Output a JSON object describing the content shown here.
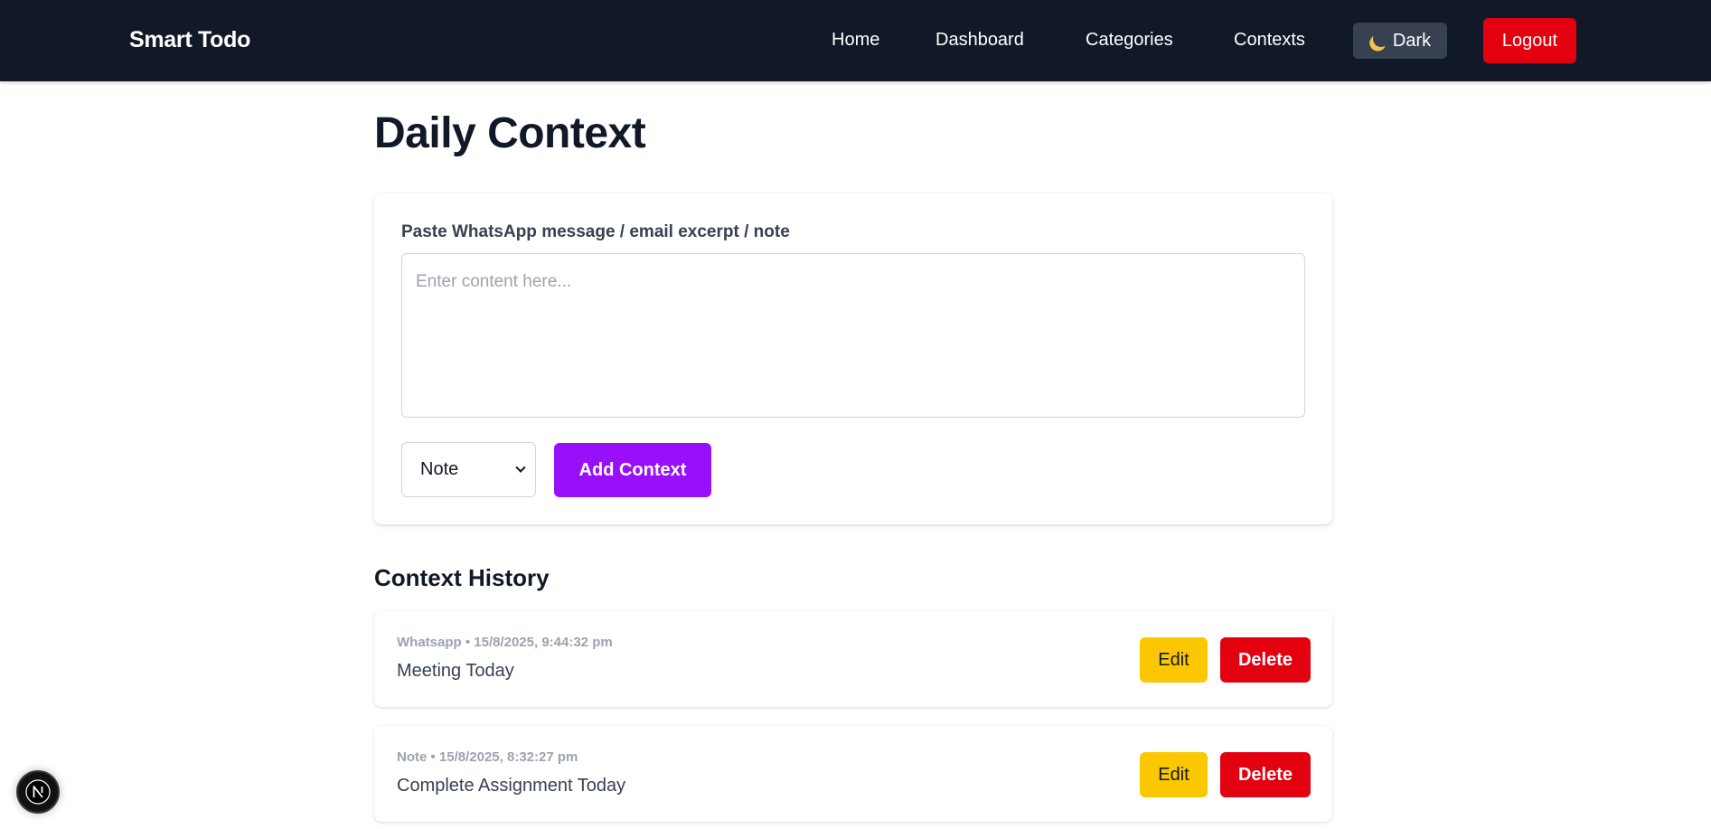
{
  "navbar": {
    "brand": "Smart Todo",
    "links": [
      "Home",
      "Dashboard",
      "Categories",
      "Contexts"
    ],
    "theme_toggle": {
      "icon": "moon-icon",
      "label": "Dark"
    },
    "logout_label": "Logout"
  },
  "page": {
    "title": "Daily Context"
  },
  "form": {
    "label": "Paste WhatsApp message / email excerpt / note",
    "textarea_placeholder": "Enter content here...",
    "textarea_value": "",
    "select_value": "Note",
    "add_button_label": "Add Context"
  },
  "history": {
    "title": "Context History",
    "entries": [
      {
        "meta": "Whatsapp • 15/8/2025, 9:44:32 pm",
        "text": "Meeting Today",
        "edit_label": "Edit",
        "delete_label": "Delete"
      },
      {
        "meta": "Note • 15/8/2025, 8:32:27 pm",
        "text": "Complete Assignment Today",
        "edit_label": "Edit",
        "delete_label": "Delete"
      }
    ]
  },
  "dev_badge": {
    "icon": "nextjs-logo-icon"
  },
  "colors": {
    "navbar_bg": "#111827",
    "accent_purple": "#9810fa",
    "danger_red": "#e3000f",
    "edit_yellow": "#fbc700",
    "theme_button_bg": "#374151"
  }
}
